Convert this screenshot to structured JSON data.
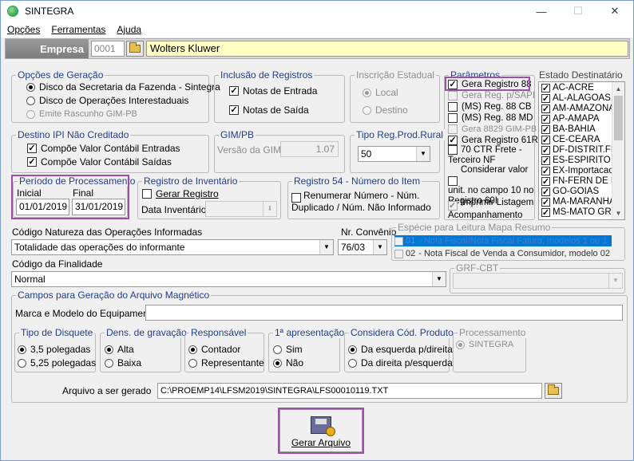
{
  "window": {
    "title": "SINTEGRA",
    "minimize": "—",
    "maximize": "☐",
    "close": "✕"
  },
  "menu": [
    "Opções",
    "Ferramentas",
    "Ajuda"
  ],
  "empresa": {
    "label": "Empresa",
    "code": "0001",
    "name": "Wolters Kluwer"
  },
  "opcoes_geracao": {
    "title": "Opções de Geração",
    "items": [
      "Disco da Secretaria da Fazenda - Sintegra",
      "Disco de Operações Interestaduais",
      "Emite Rascunho GIM-PB"
    ]
  },
  "inclusao": {
    "title": "Inclusão de Registros",
    "items": [
      "Notas de Entrada",
      "Notas de Saída"
    ]
  },
  "inscricao": {
    "title": "Inscrição Estadual",
    "items": [
      "Local",
      "Destino"
    ]
  },
  "parametros": {
    "title": "Parâmetros",
    "items": [
      "Gera Registro 88",
      "Gera Reg. p/SAPI",
      "(MS) Reg. 88 CB",
      "(MS) Reg. 88 MD",
      "Gera 8829 GIM-PB",
      "Gera Registro 61R",
      "70 CTR Frete - Terceiro NF",
      "Considerar valor unit. no campo 10 no Registro 60I",
      "Imprimir Listagem Acompanhamento"
    ]
  },
  "estado": {
    "title": "Estado Destinatário",
    "items": [
      "AC-ACRE",
      "AL-ALAGOAS",
      "AM-AMAZONAS",
      "AP-AMAPA",
      "BA-BAHIA",
      "CE-CEARA",
      "DF-DISTRIT.FE",
      "ES-ESPIRITO S",
      "EX-Importacao,",
      "FN-FERN DE NC",
      "GO-GOIAS",
      "MA-MARANHAO",
      "MS-MATO GRO"
    ]
  },
  "destino_ipi": {
    "title": "Destino IPI Não Creditado",
    "items": [
      "Compõe Valor Contábil Entradas",
      "Compõe Valor Contábil Saídas"
    ]
  },
  "gim_pb": {
    "title": "GIM/PB",
    "label": "Versão da GIM",
    "value": "1.07"
  },
  "tipo_reg": {
    "title": "Tipo Reg.Prod.Rural",
    "value": "50"
  },
  "periodo": {
    "title": "Período de Processamento",
    "inicial_label": "Inicial",
    "final_label": "Final",
    "inicial": "01/01/2019",
    "final": "31/01/2019"
  },
  "inventario": {
    "title": "Registro de Inventário",
    "check": "Gerar Registro",
    "data_label": "Data Inventário"
  },
  "reg54": {
    "title": "Registro 54 - Número do Item",
    "check": "Renumerar Número - Núm. Duplicado / Núm. Não Informado"
  },
  "natureza": {
    "label": "Código Natureza das Operações Informadas",
    "value": "Totalidade das operações do informante"
  },
  "convenio": {
    "label": "Nr. Convênio",
    "value": "76/03"
  },
  "especie": {
    "title": "Espécie para Leitura Mapa Resumo",
    "items": [
      {
        "code": "01",
        "text": "- Nota Fiscal/Nota Fiscal Fatura, modelos 1 ou 1"
      },
      {
        "code": "02",
        "text": "- Nota Fiscal de Venda a Consumidor, modelo 02"
      }
    ]
  },
  "finalidade": {
    "label": "Código da Finalidade",
    "value": "Normal"
  },
  "grf_cbt": {
    "title": "GRF-CBT"
  },
  "campos": {
    "title": "Campos para Geração do Arquivo Magnético",
    "marca_label": "Marca e Modelo do Equipamento"
  },
  "tipo_disquete": {
    "title": "Tipo de Disquete",
    "items": [
      "3,5 polegadas",
      "5,25 polegadas"
    ]
  },
  "densidade": {
    "title": "Dens. de gravação",
    "items": [
      "Alta",
      "Baixa"
    ]
  },
  "responsavel": {
    "title": "Responsável",
    "items": [
      "Contador",
      "Representante"
    ]
  },
  "apresentacao": {
    "title": "1ª apresentação",
    "items": [
      "Sim",
      "Não"
    ]
  },
  "considera": {
    "title": "Considera Cód. Produto",
    "items": [
      "Da esquerda p/direita",
      "Da direita p/esquerda"
    ]
  },
  "processamento": {
    "title": "Processamento",
    "items": [
      "SINTEGRA"
    ]
  },
  "arquivo": {
    "label": "Arquivo a ser gerado",
    "value": "C:\\PROEMP14\\LFSM2019\\SINTEGRA\\LFS00010119.TXT"
  },
  "gerar": {
    "label": "Gerar Arquivo"
  },
  "colors": {
    "highlight": "#9b4fa6",
    "legend": "#1f3e8c",
    "selection": "#0078d7",
    "empresa_field": "#ffffc4"
  }
}
